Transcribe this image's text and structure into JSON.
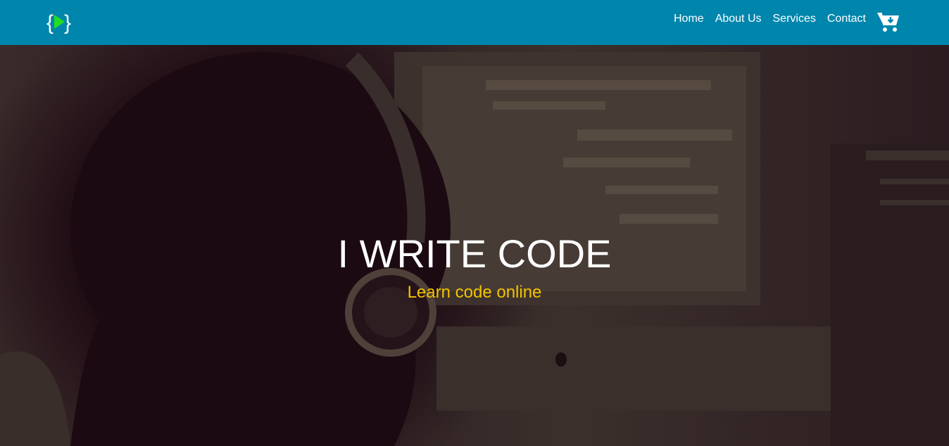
{
  "header": {
    "logo_icon": "brackets-play-logo-icon",
    "background": "#0086ad",
    "nav": [
      {
        "label": "Home"
      },
      {
        "label": "About Us"
      },
      {
        "label": "Services"
      },
      {
        "label": "Contact"
      }
    ],
    "cart_icon": "cart-download-icon"
  },
  "hero": {
    "title": "I WRITE CODE",
    "subtitle": "Learn code online",
    "subtitle_color": "#f2c400",
    "background_image": "person-with-headphones-at-computer"
  }
}
